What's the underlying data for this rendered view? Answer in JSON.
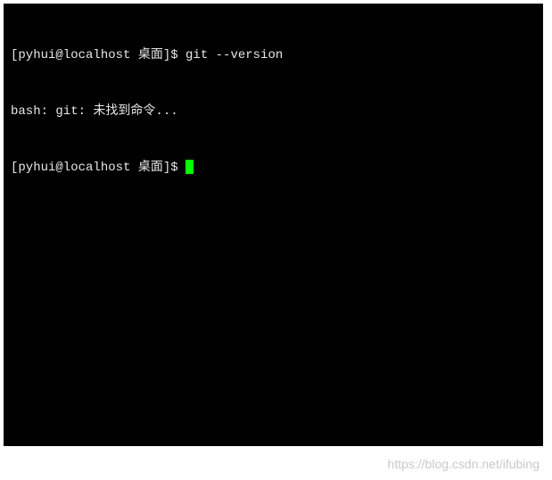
{
  "terminal": {
    "lines": [
      {
        "prompt": "[pyhui@localhost 桌面]$ ",
        "command": "git --version"
      },
      {
        "output": "bash: git: 未找到命令..."
      },
      {
        "prompt": "[pyhui@localhost 桌面]$ ",
        "command": "",
        "cursor": true
      }
    ]
  },
  "watermark": "https://blog.csdn.net/ifubing"
}
